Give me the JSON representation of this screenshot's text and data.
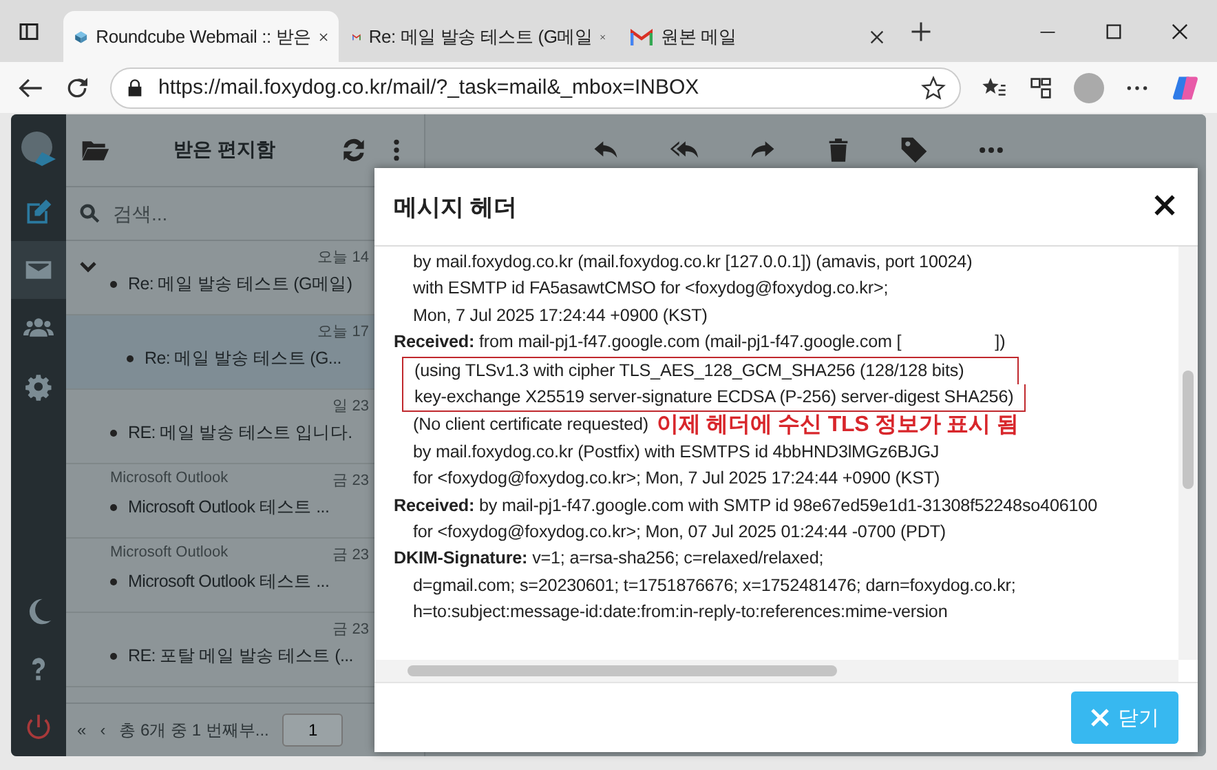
{
  "browser": {
    "tabs": [
      {
        "title": "Roundcube Webmail :: 받은",
        "kind": "roundcube",
        "selected": true
      },
      {
        "title": "Re: 메일 발송 테스트 (G메일",
        "kind": "gmail",
        "selected": false
      },
      {
        "title": "원본 메일",
        "kind": "gmail",
        "selected": false
      }
    ],
    "url": "https://mail.foxydog.co.kr/mail/?_task=mail&_mbox=INBOX"
  },
  "sidebar": {
    "items": [
      {
        "kind": "compose",
        "selected": false
      },
      {
        "kind": "mail",
        "selected": true
      },
      {
        "kind": "contacts",
        "selected": false
      },
      {
        "kind": "settings",
        "selected": false
      }
    ]
  },
  "folder": {
    "title": "받은 편지함",
    "search_placeholder": "검색..."
  },
  "messages": [
    {
      "date": "오늘 14",
      "subject": "Re: 메일 발송 테스트 (G메일)",
      "thread": true,
      "child": false,
      "selected": false
    },
    {
      "date": "오늘 17",
      "subject": "Re: 메일 발송 테스트 (G...",
      "thread": false,
      "child": true,
      "selected": true
    },
    {
      "date": "일 23",
      "subject": "RE: 메일 발송 테스트 입니다.",
      "thread": false,
      "child": false,
      "selected": false
    },
    {
      "sender": "Microsoft Outlook",
      "date": "금 23",
      "subject": "Microsoft Outlook 테스트 ...",
      "thread": false,
      "child": false,
      "selected": false
    },
    {
      "sender": "Microsoft Outlook",
      "date": "금 23",
      "subject": "Microsoft Outlook 테스트 ...",
      "thread": false,
      "child": false,
      "selected": false
    },
    {
      "date": "금 23",
      "subject": "RE: 포탈 메일 발송 테스트 (...",
      "thread": false,
      "child": false,
      "selected": false
    }
  ],
  "pager": {
    "first": "«",
    "prev": "‹",
    "count": "총 6개 중 1 번째부...",
    "page": "1"
  },
  "dialog": {
    "title": "메시지 헤더",
    "close_label": "닫기",
    "headers": [
      {
        "lines": [
          {
            "text": "by mail.foxydog.co.kr (mail.foxydog.co.kr [127.0.0.1]) (amavis, port 10024)",
            "boxed": false
          },
          {
            "text": "with ESMTP id FA5asawtCMSO for <foxydog@foxydog.co.kr>;",
            "boxed": false
          },
          {
            "text": "Mon, 7 Jul 2025 17:24:44 +0900 (KST)",
            "boxed": false
          }
        ]
      },
      {
        "name": "Received:",
        "lines": [
          {
            "text": "from mail-pj1-f47.google.com (mail-pj1-f47.google.com [                    ])",
            "boxed": false
          },
          {
            "text": "(using TLSv1.3 with cipher TLS_AES_128_GCM_SHA256 (128/128 bits)",
            "boxed": true
          },
          {
            "text": "key-exchange X25519 server-signature ECDSA (P-256) server-digest SHA256)",
            "boxed": true
          },
          {
            "text": "(No client certificate requested)",
            "boxed": false,
            "note": "이제 헤더에 수신 TLS 정보가 표시 됨"
          },
          {
            "text": "by mail.foxydog.co.kr (Postfix) with ESMTPS id 4bbHND3lMGz6BJGJ",
            "boxed": false
          },
          {
            "text": "for <foxydog@foxydog.co.kr>; Mon, 7 Jul 2025 17:24:44 +0900 (KST)",
            "boxed": false
          }
        ]
      },
      {
        "name": "Received:",
        "lines": [
          {
            "text": "by mail-pj1-f47.google.com with SMTP id 98e67ed59e1d1-31308f52248so406100",
            "boxed": false
          },
          {
            "text": "for <foxydog@foxydog.co.kr>; Mon, 07 Jul 2025 01:24:44 -0700 (PDT)",
            "boxed": false
          }
        ]
      },
      {
        "name": "DKIM-Signature:",
        "lines": [
          {
            "text": "v=1; a=rsa-sha256; c=relaxed/relaxed;",
            "boxed": false
          },
          {
            "text": "d=gmail.com; s=20230601; t=1751876676; x=1752481476; darn=foxydog.co.kr;",
            "boxed": false
          },
          {
            "text": "h=to:subject:message-id:date:from:in-reply-to:references:mime-version",
            "boxed": false
          }
        ]
      }
    ]
  }
}
